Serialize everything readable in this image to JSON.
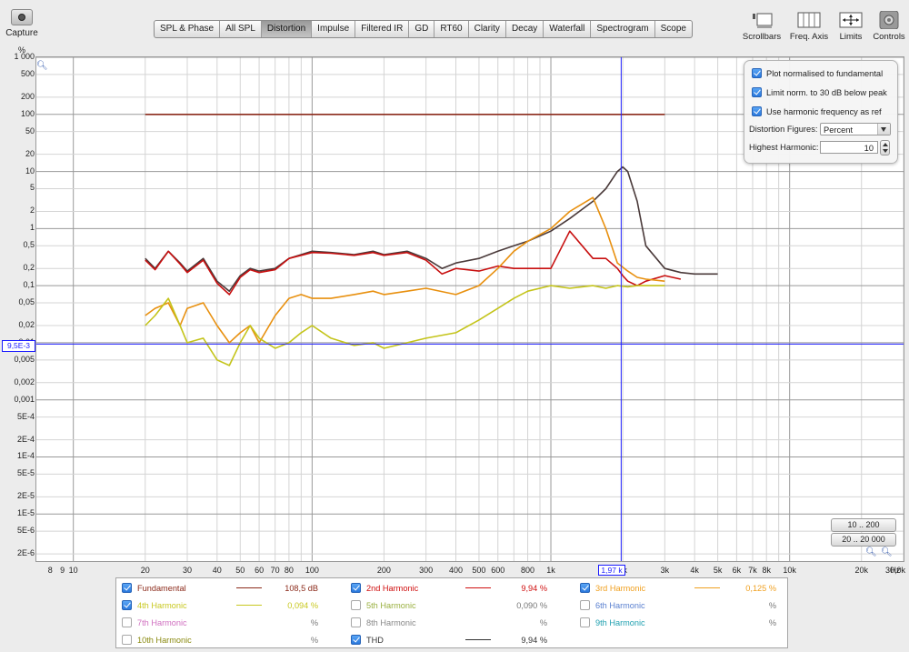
{
  "toolbar": {
    "capture_label": "Capture",
    "tabs": [
      "SPL & Phase",
      "All SPL",
      "Distortion",
      "Impulse",
      "Filtered IR",
      "GD",
      "RT60",
      "Clarity",
      "Decay",
      "Waterfall",
      "Spectrogram",
      "Scope"
    ],
    "active_tab": "Distortion",
    "right_tools": [
      "Scrollbars",
      "Freq. Axis",
      "Limits",
      "Controls"
    ]
  },
  "axis": {
    "y_unit": "%",
    "y_ticks": [
      "1 000",
      "500",
      "200",
      "100",
      "50",
      "20",
      "10",
      "5",
      "2",
      "1",
      "0,5",
      "0,2",
      "0,1",
      "0,05",
      "0,02",
      "0,01",
      "0,005",
      "0,002",
      "0,001",
      "5E-4",
      "2E-4",
      "1E-4",
      "5E-5",
      "2E-5",
      "1E-5",
      "5E-6",
      "2E-6"
    ],
    "y_tick_values": [
      1000,
      500,
      200,
      100,
      50,
      20,
      10,
      5,
      2,
      1,
      0.5,
      0.2,
      0.1,
      0.05,
      0.02,
      0.01,
      0.005,
      0.002,
      0.001,
      0.0005,
      0.0002,
      0.0001,
      5e-05,
      2e-05,
      1e-05,
      5e-06,
      2e-06
    ],
    "x_ticks": [
      "8",
      "9",
      "10",
      "20",
      "30",
      "40",
      "50",
      "60",
      "70",
      "80",
      "100",
      "200",
      "300",
      "400",
      "500",
      "600",
      "800",
      "1k",
      "2k",
      "3k",
      "4k",
      "5k",
      "6k",
      "7k",
      "8k",
      "10k",
      "20k",
      "30,0k",
      "Hz"
    ],
    "x_tick_values": [
      8,
      9,
      10,
      20,
      30,
      40,
      50,
      60,
      70,
      80,
      100,
      200,
      300,
      400,
      500,
      600,
      800,
      1000,
      2000,
      3000,
      4000,
      5000,
      6000,
      7000,
      8000,
      10000,
      20000,
      30000,
      null
    ],
    "x_range_hz": [
      7,
      30000
    ],
    "y_range_pct": [
      1.5e-06,
      1000
    ],
    "x_scale": "log",
    "y_scale": "log",
    "cursor_x": "1,97 k",
    "cursor_y": "9,5E-3"
  },
  "controls": {
    "plot_normalised": "Plot normalised to fundamental",
    "limit_norm": "Limit norm. to 30 dB below peak",
    "use_harmonic_freq": "Use harmonic frequency as ref",
    "figures_label": "Distortion Figures:",
    "figures_value": "Percent",
    "highest_label": "Highest Harmonic:",
    "highest_value": "10"
  },
  "range_buttons": [
    "10 .. 200",
    "20 .. 20 000"
  ],
  "legend": [
    {
      "name": "Fundamental",
      "checked": true,
      "value": "108,5 dB",
      "color": "#8b2a1a"
    },
    {
      "name": "2nd Harmonic",
      "checked": true,
      "value": "9,94 %",
      "color": "#d01010"
    },
    {
      "name": "3rd Harmonic",
      "checked": true,
      "value": "0,125 %",
      "color": "#f0a020"
    },
    {
      "name": "4th Harmonic",
      "checked": true,
      "value": "0,094 %",
      "color": "#c8c820"
    },
    {
      "name": "5th Harmonic",
      "checked": false,
      "value": "0,090 %",
      "color": "#9ab040"
    },
    {
      "name": "6th Harmonic",
      "checked": false,
      "value": "%",
      "color": "#5a80d0"
    },
    {
      "name": "7th Harmonic",
      "checked": false,
      "value": "%",
      "color": "#d070c0"
    },
    {
      "name": "8th Harmonic",
      "checked": false,
      "value": "%",
      "color": "#888888"
    },
    {
      "name": "9th Harmonic",
      "checked": false,
      "value": "%",
      "color": "#20a0b0"
    },
    {
      "name": "10th Harmonic",
      "checked": false,
      "value": "%",
      "color": "#8a8a10"
    },
    {
      "name": "THD",
      "checked": true,
      "value": "9,94 %",
      "color": "#333333"
    }
  ],
  "chart_data": {
    "type": "line",
    "xlabel": "Hz",
    "ylabel": "%",
    "xlim": [
      7,
      30000
    ],
    "ylim": [
      1.5e-06,
      1000
    ],
    "series": [
      {
        "name": "Fundamental",
        "color": "#8b2a1a",
        "x": [
          20,
          3000
        ],
        "values": [
          100,
          100
        ]
      },
      {
        "name": "THD",
        "color": "#4a3a3a",
        "x": [
          20,
          22,
          25,
          28,
          30,
          35,
          40,
          45,
          50,
          55,
          60,
          70,
          80,
          90,
          100,
          120,
          150,
          180,
          200,
          250,
          300,
          350,
          400,
          500,
          600,
          700,
          800,
          1000,
          1200,
          1500,
          1700,
          1900,
          2000,
          2100,
          2300,
          2500,
          3000,
          3500,
          4000,
          5000
        ],
        "values": [
          0.3,
          0.2,
          0.4,
          0.25,
          0.18,
          0.3,
          0.12,
          0.08,
          0.15,
          0.2,
          0.18,
          0.2,
          0.3,
          0.35,
          0.4,
          0.38,
          0.35,
          0.4,
          0.35,
          0.4,
          0.3,
          0.2,
          0.25,
          0.3,
          0.4,
          0.5,
          0.6,
          0.9,
          1.5,
          3,
          5,
          10,
          12,
          10,
          3,
          0.5,
          0.2,
          0.17,
          0.16,
          0.16
        ]
      },
      {
        "name": "2nd Harmonic",
        "color": "#c81010",
        "x": [
          20,
          22,
          25,
          28,
          30,
          35,
          40,
          45,
          50,
          55,
          60,
          70,
          80,
          90,
          100,
          120,
          150,
          180,
          200,
          250,
          300,
          350,
          400,
          500,
          600,
          700,
          800,
          1000,
          1200,
          1500,
          1700,
          1900,
          2000,
          2100,
          2300,
          2500,
          3000,
          3500
        ],
        "values": [
          0.28,
          0.19,
          0.4,
          0.24,
          0.17,
          0.28,
          0.11,
          0.07,
          0.14,
          0.19,
          0.17,
          0.19,
          0.3,
          0.34,
          0.38,
          0.37,
          0.34,
          0.38,
          0.34,
          0.38,
          0.28,
          0.16,
          0.2,
          0.18,
          0.22,
          0.2,
          0.2,
          0.2,
          0.9,
          0.3,
          0.3,
          0.2,
          0.15,
          0.12,
          0.1,
          0.12,
          0.15,
          0.13
        ]
      },
      {
        "name": "3rd Harmonic",
        "color": "#e8900f",
        "x": [
          20,
          22,
          25,
          28,
          30,
          35,
          40,
          45,
          50,
          55,
          60,
          70,
          80,
          90,
          100,
          120,
          150,
          180,
          200,
          250,
          300,
          400,
          500,
          600,
          700,
          800,
          1000,
          1200,
          1500,
          1700,
          1900,
          2100,
          2300,
          2500,
          3000
        ],
        "values": [
          0.03,
          0.04,
          0.05,
          0.02,
          0.04,
          0.05,
          0.02,
          0.01,
          0.015,
          0.02,
          0.01,
          0.03,
          0.06,
          0.07,
          0.06,
          0.06,
          0.07,
          0.08,
          0.07,
          0.08,
          0.09,
          0.07,
          0.1,
          0.2,
          0.4,
          0.6,
          1,
          2,
          3.5,
          1,
          0.25,
          0.18,
          0.14,
          0.13,
          0.12
        ]
      },
      {
        "name": "4th Harmonic",
        "color": "#c4c41a",
        "x": [
          20,
          22,
          25,
          28,
          30,
          35,
          40,
          45,
          50,
          55,
          60,
          70,
          80,
          90,
          100,
          120,
          150,
          180,
          200,
          250,
          300,
          400,
          500,
          600,
          700,
          800,
          1000,
          1200,
          1500,
          1700,
          1900,
          2100,
          2300,
          2500,
          3000
        ],
        "values": [
          0.02,
          0.03,
          0.06,
          0.02,
          0.01,
          0.012,
          0.005,
          0.004,
          0.01,
          0.02,
          0.012,
          0.008,
          0.01,
          0.015,
          0.02,
          0.012,
          0.009,
          0.01,
          0.008,
          0.01,
          0.012,
          0.015,
          0.025,
          0.04,
          0.06,
          0.08,
          0.1,
          0.09,
          0.1,
          0.09,
          0.1,
          0.095,
          0.1,
          0.1,
          0.1
        ]
      }
    ]
  }
}
